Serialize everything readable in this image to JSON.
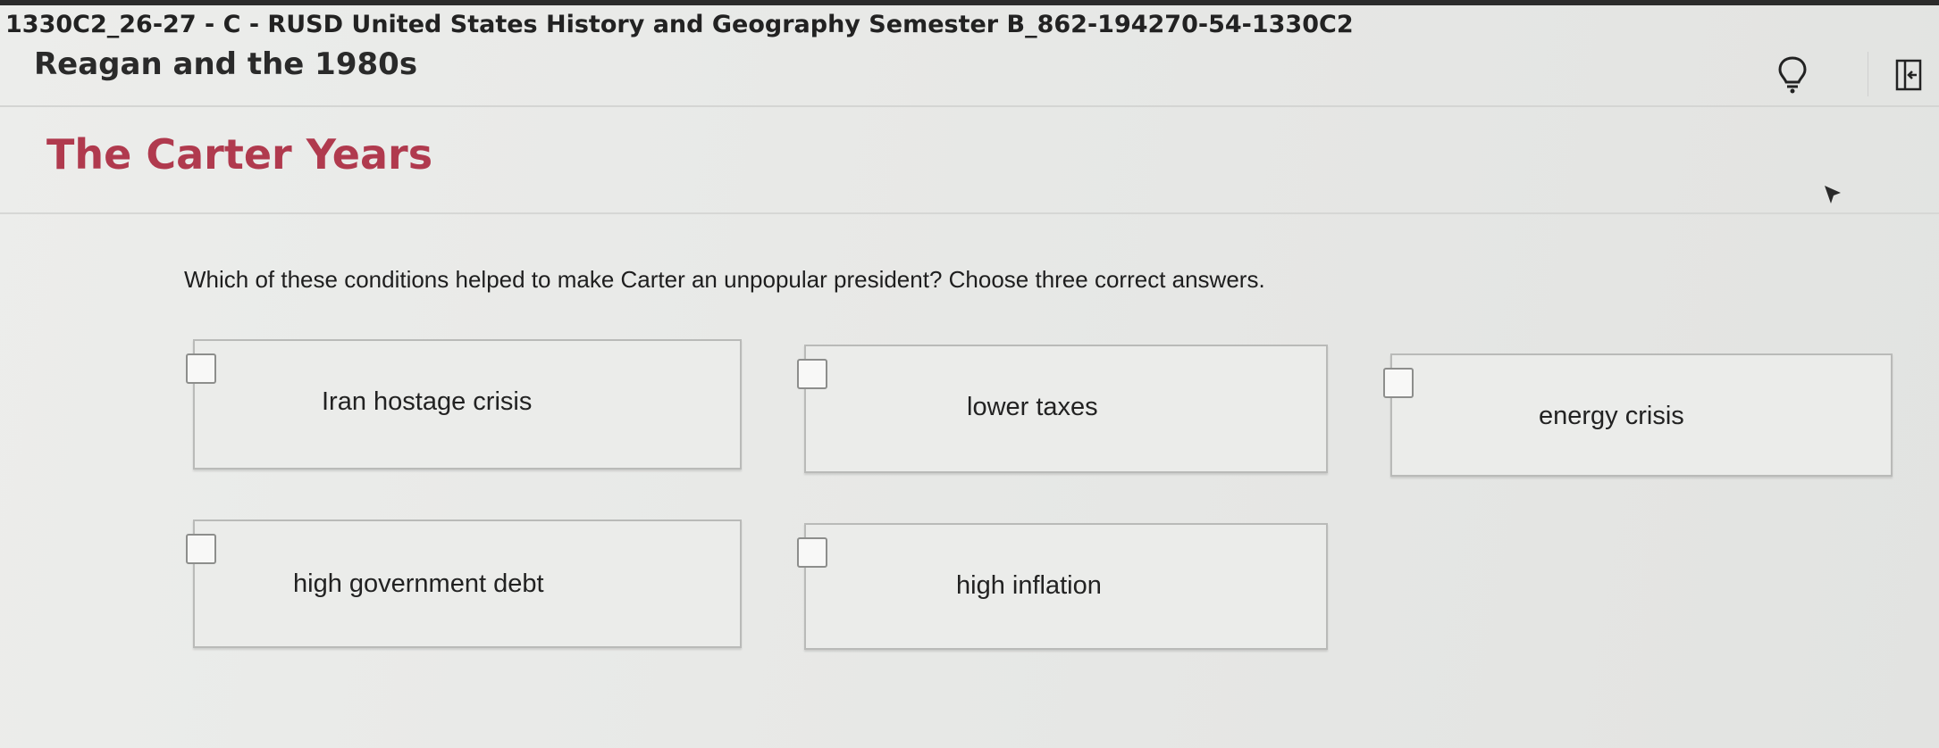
{
  "header": {
    "course_title": "1330C2_26-27 - C - RUSD United States History and Geography Semester B_862-194270-54-1330C2",
    "unit_title": "Reagan and the 1980s",
    "tools": {
      "hint_icon": "lightbulb-icon",
      "exit_icon": "exit-door-icon"
    }
  },
  "section": {
    "title": "The Carter Years"
  },
  "question": {
    "prompt": "Which of these conditions helped to make Carter an unpopular president? Choose three correct answers.",
    "choices": [
      {
        "label": "Iran hostage crisis",
        "checked": false
      },
      {
        "label": "lower taxes",
        "checked": false
      },
      {
        "label": "energy crisis",
        "checked": false
      },
      {
        "label": "high government debt",
        "checked": false
      },
      {
        "label": "high inflation",
        "checked": false
      }
    ]
  },
  "colors": {
    "section_title": "#b03a4e",
    "background": "#e8e9e7",
    "choice_border": "#b9bab8"
  }
}
